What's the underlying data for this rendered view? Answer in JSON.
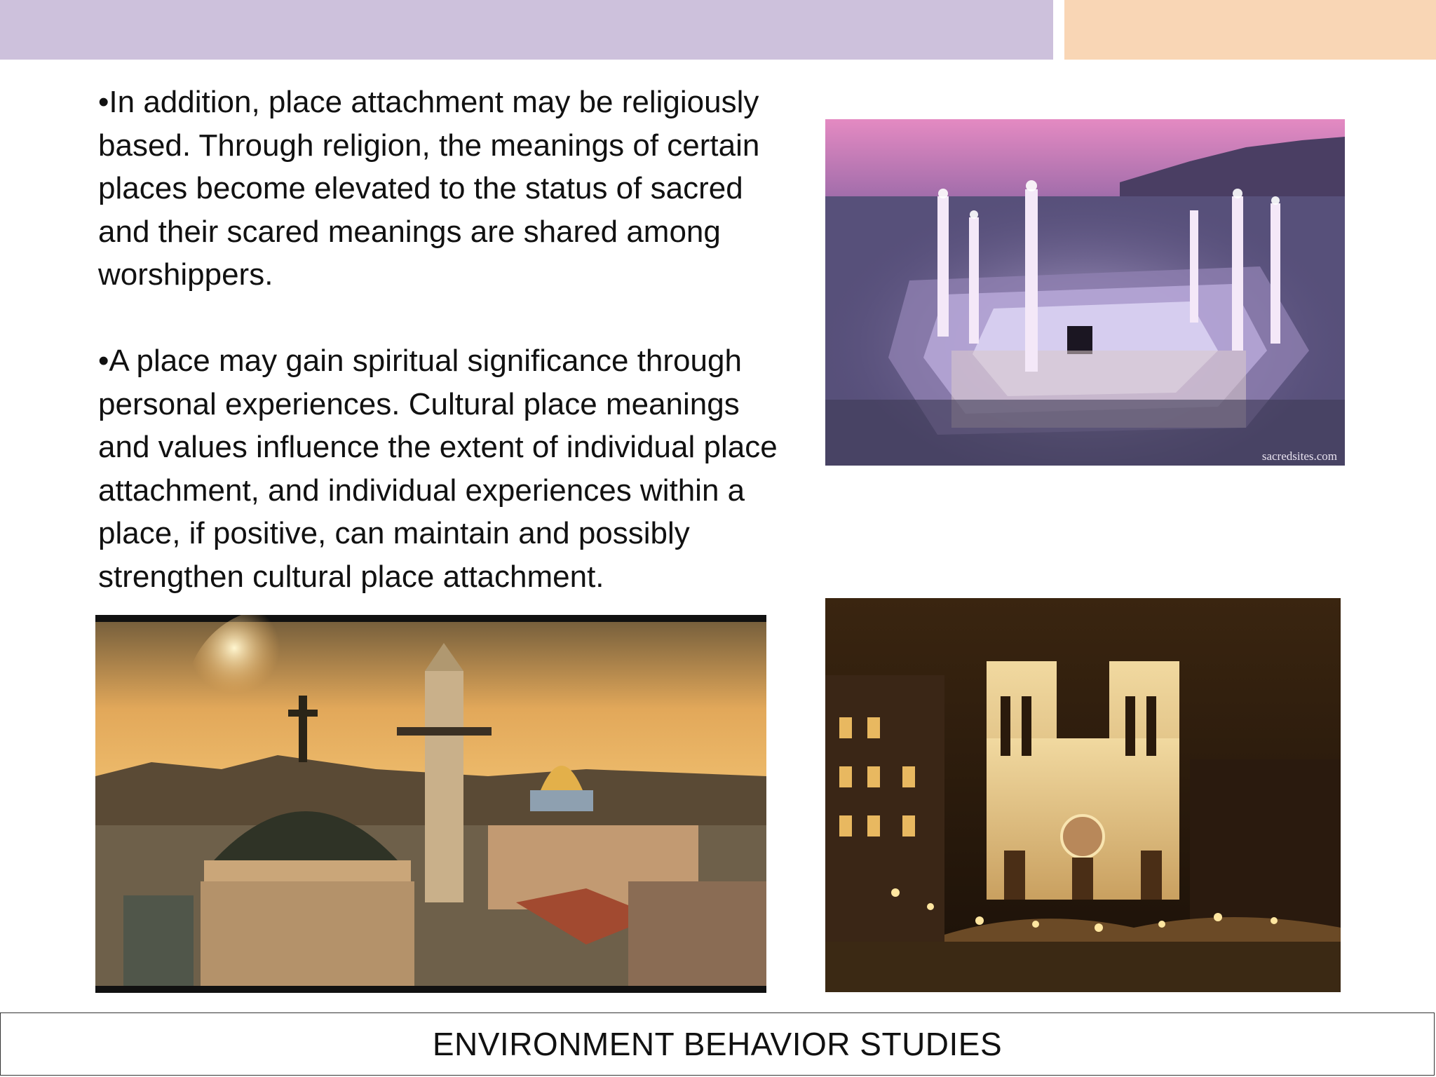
{
  "header": {
    "left_band_color": "#cdc1dc",
    "right_band_color": "#f9d6b5"
  },
  "content": {
    "paragraphs": [
      "•In addition, place attachment may be religiously based. Through religion, the meanings of certain places become elevated to the status of sacred and their scared meanings are shared among worshippers.",
      "•A place may gain spiritual significance through personal experiences. Cultural place meanings and values influence the extent of individual place attachment, and individual experiences within a place, if positive, can maintain and possibly strengthen cultural place attachment."
    ]
  },
  "images": {
    "mecca_watermark": "sacredsites.com"
  },
  "footer": {
    "title": "ENVIRONMENT BEHAVIOR STUDIES"
  }
}
